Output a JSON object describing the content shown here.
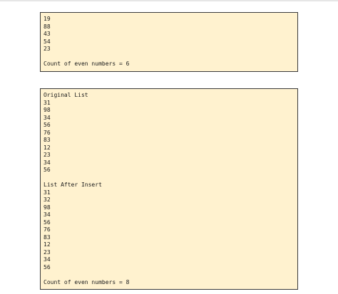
{
  "output_1": {
    "numbers": [
      "19",
      "88",
      "43",
      "54",
      "23"
    ],
    "count_label": "Count of even numbers = 6"
  },
  "output_2": {
    "original_heading": "Original List",
    "original_numbers": [
      "31",
      "98",
      "34",
      "56",
      "76",
      "83",
      "12",
      "23",
      "34",
      "56"
    ],
    "after_heading": "List After Insert",
    "after_numbers": [
      "31",
      "32",
      "98",
      "34",
      "56",
      "76",
      "83",
      "12",
      "23",
      "34",
      "56"
    ],
    "count_label": "Count of even numbers = 8"
  }
}
